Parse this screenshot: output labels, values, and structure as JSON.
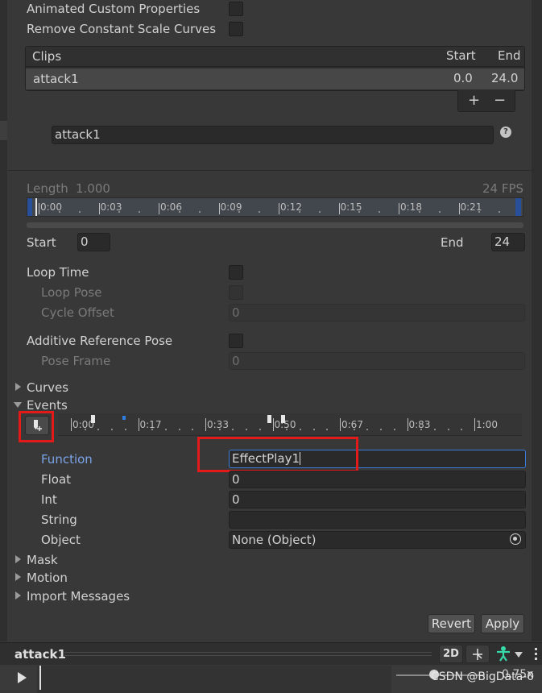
{
  "top": {
    "animated_custom_properties": "Animated Custom Properties",
    "remove_constant_scale_curves": "Remove Constant Scale Curves"
  },
  "clips": {
    "header": "Clips",
    "col_start": "Start",
    "col_end": "End",
    "rows": [
      {
        "name": "attack1",
        "start": "0.0",
        "end": "24.0"
      }
    ],
    "add_label": "+",
    "remove_label": "−"
  },
  "clip_name_value": "attack1",
  "help_glyph": "?",
  "timeline": {
    "length_label": "Length",
    "length_value": "1.000",
    "fps": "24 FPS",
    "ticks": [
      "0:00",
      "0:03",
      "0:06",
      "0:09",
      "0:12",
      "0:15",
      "0:18",
      "0:21"
    ],
    "start_label": "Start",
    "start_value": "0",
    "end_label": "End",
    "end_value": "24"
  },
  "loop": {
    "loop_time": "Loop Time",
    "loop_pose": "Loop Pose",
    "cycle_offset": "Cycle Offset",
    "cycle_offset_value": "0",
    "additive_reference_pose": "Additive Reference Pose",
    "pose_frame": "Pose Frame",
    "pose_frame_value": "0"
  },
  "sections": {
    "curves": "Curves",
    "events": "Events",
    "mask": "Mask",
    "motion": "Motion",
    "import_messages": "Import Messages"
  },
  "events_ruler": {
    "ticks": [
      "0:00",
      "0:17",
      "0:33",
      "0:50",
      "0:67",
      "0:83",
      "1:00"
    ]
  },
  "event_props": {
    "function_label": "Function",
    "function_value": "EffectPlay1",
    "float_label": "Float",
    "float_value": "0",
    "int_label": "Int",
    "int_value": "0",
    "string_label": "String",
    "string_value": "",
    "object_label": "Object",
    "object_value": "None (Object)"
  },
  "actions": {
    "revert": "Revert",
    "apply": "Apply"
  },
  "preview": {
    "title": "attack1",
    "mode_2d": "2D",
    "speed": "0.75x",
    "watermark": "CSDN @BigData-0"
  },
  "colors": {
    "panel_bg": "#383838",
    "field_bg": "#2a2a2a",
    "highlight_red": "#e21a1a",
    "function_label": "#7ba4e8",
    "avatar_accent": "#38d9a9",
    "selected_field_border": "#3d7bd8"
  }
}
